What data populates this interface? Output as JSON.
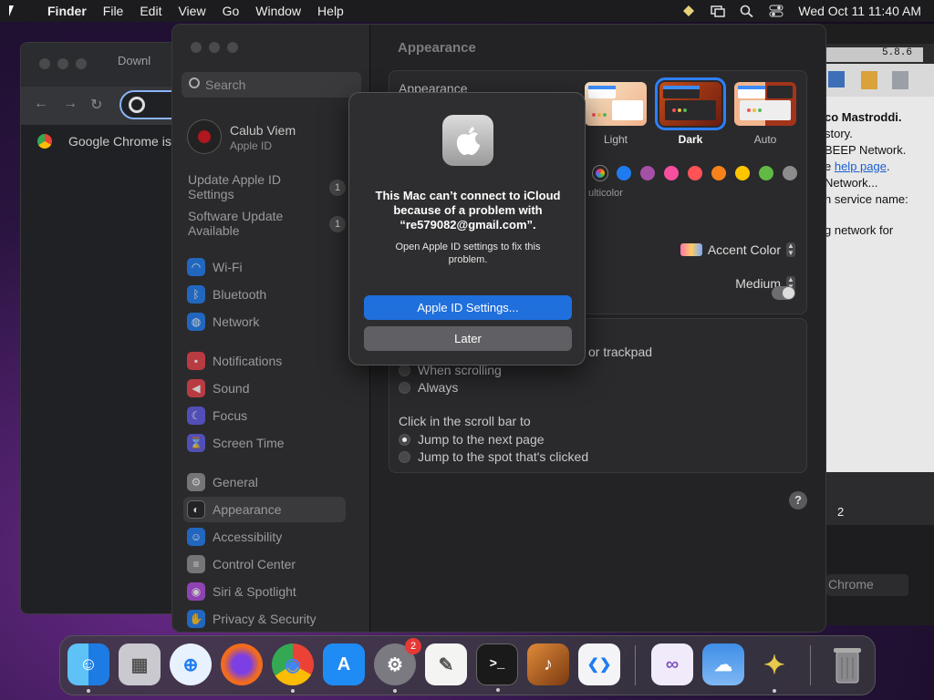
{
  "menubar": {
    "app_name": "Finder",
    "items": [
      "File",
      "Edit",
      "View",
      "Go",
      "Window",
      "Help"
    ],
    "datetime": "Wed Oct 11  11:40 AM",
    "icons": [
      "apple-icon",
      "shortcuts-icon",
      "screen-mirroring-icon",
      "spotlight-search-icon",
      "control-center-icon"
    ]
  },
  "chrome_window": {
    "tab_title": "Downl",
    "infobar_text": "Google Chrome isr"
  },
  "bg_window": {
    "version": "5.8.6",
    "lines": [
      "co Mastroddi.",
      "story.",
      "BEEP Network.",
      "e ",
      "help page",
      ".",
      "Network...",
      "h service name:",
      "g network for"
    ],
    "status_count": "2",
    "chrome_label": "Chrome"
  },
  "sidebar": {
    "search_placeholder": "Search",
    "profile_name": "Calub Viem",
    "profile_sub": "Apple ID",
    "notices": [
      {
        "label": "Update Apple ID Settings",
        "badge": "1"
      },
      {
        "label": "Software Update Available",
        "badge": "1"
      }
    ],
    "items": [
      {
        "label": "Wi-Fi",
        "icon": "wifi-icon",
        "color": "#1f7cf0"
      },
      {
        "label": "Bluetooth",
        "icon": "bluetooth-icon",
        "color": "#1f7cf0"
      },
      {
        "label": "Network",
        "icon": "globe-icon",
        "color": "#1f7cf0"
      },
      {
        "label": "Notifications",
        "icon": "bell-icon",
        "color": "#e8414a"
      },
      {
        "label": "Sound",
        "icon": "speaker-icon",
        "color": "#e8414a"
      },
      {
        "label": "Focus",
        "icon": "moon-icon",
        "color": "#5e5ce6"
      },
      {
        "label": "Screen Time",
        "icon": "hourglass-icon",
        "color": "#5e5ce6"
      },
      {
        "label": "General",
        "icon": "gear-icon",
        "color": "#8e8e93"
      },
      {
        "label": "Appearance",
        "icon": "appearance-icon",
        "color": "#1c1c1e"
      },
      {
        "label": "Accessibility",
        "icon": "accessibility-icon",
        "color": "#1f7cf0"
      },
      {
        "label": "Control Center",
        "icon": "control-center-icon",
        "color": "#8e8e93"
      },
      {
        "label": "Siri & Spotlight",
        "icon": "siri-icon",
        "color": "#b04be0"
      },
      {
        "label": "Privacy & Security",
        "icon": "hand-icon",
        "color": "#1f7cf0"
      }
    ],
    "selected": "Appearance"
  },
  "main": {
    "title": "Appearance",
    "appearance_label": "Appearance",
    "themes": [
      {
        "label": "Light",
        "selected": false
      },
      {
        "label": "Dark",
        "selected": true
      },
      {
        "label": "Auto",
        "selected": false
      }
    ],
    "accent_swatches": [
      "multicolor",
      "#1f7cf0",
      "#a550a7",
      "#f74f9e",
      "#ff5257",
      "#f7821b",
      "#ffc600",
      "#62ba46",
      "#8c8c8c"
    ],
    "multicolor_label": "ulticolor",
    "highlight_popup": "Accent Color",
    "sidebar_size_popup": "Medium",
    "scroll_title_fragment": "or trackpad",
    "show_scroll_options": [
      "When scrolling",
      "Always"
    ],
    "click_label": "Click in the scroll bar to",
    "click_options": [
      {
        "label": "Jump to the next page",
        "selected": true
      },
      {
        "label": "Jump to the spot that's clicked",
        "selected": false
      }
    ],
    "help": "?"
  },
  "alert": {
    "title": "This Mac can’t connect to iCloud because of a problem with “re579082@gmail.com”.",
    "message": "Open Apple ID settings to fix this problem.",
    "primary_button": "Apple ID Settings...",
    "secondary_button": "Later"
  },
  "dock": {
    "items": [
      {
        "name": "finder",
        "color": "#2b8cf0",
        "glyph": "☺",
        "running": true
      },
      {
        "name": "launchpad",
        "color": "#c9c9cf",
        "glyph": "▦",
        "running": false
      },
      {
        "name": "safari",
        "color": "#e8f2ff",
        "glyph": "⊕",
        "running": false
      },
      {
        "name": "firefox",
        "color": "#f16b1f",
        "glyph": "●",
        "running": false
      },
      {
        "name": "chrome",
        "color": "#f1f1f1",
        "glyph": "◉",
        "running": true
      },
      {
        "name": "app-store",
        "color": "#1f8cf5",
        "glyph": "A",
        "running": false
      },
      {
        "name": "system-settings",
        "color": "#7a7a80",
        "glyph": "⚙",
        "running": true,
        "badge": "2"
      },
      {
        "name": "textedit",
        "color": "#f4f4f2",
        "glyph": "✎",
        "running": false
      },
      {
        "name": "terminal",
        "color": "#1a1a1a",
        "glyph": ">_",
        "running": true
      },
      {
        "name": "garageband",
        "color": "#c46b2a",
        "glyph": "♪",
        "running": false
      },
      {
        "name": "vscode",
        "color": "#f4f4f6",
        "glyph": "❮❯",
        "running": false
      },
      {
        "name": "visual-studio",
        "color": "#f0eafa",
        "glyph": "∞",
        "running": false
      },
      {
        "name": "weather",
        "color": "#3f8ee8",
        "glyph": "☁",
        "running": false
      },
      {
        "name": "cyberduck",
        "color": "#e6c84a",
        "glyph": "✦",
        "running": true
      },
      {
        "name": "trash",
        "color": "#6d6d70",
        "glyph": "🗑",
        "running": false
      }
    ]
  }
}
